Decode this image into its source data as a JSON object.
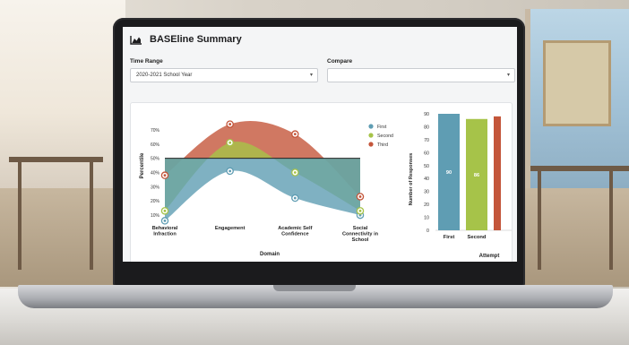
{
  "app": {
    "title": "BASEline Summary",
    "icon": "area-chart-icon"
  },
  "filters": {
    "time_range_label": "Time Range",
    "time_range_value": "2020-2021 School Year",
    "compare_label": "Compare",
    "compare_value": ""
  },
  "colors": {
    "first": "#5f9db3",
    "second": "#a6c349",
    "third": "#c4563b"
  },
  "chart_data": [
    {
      "type": "area",
      "xlabel": "Domain",
      "ylabel": "Percentile",
      "categories": [
        "Behavioral Infraction",
        "Engagement",
        "Academic Self Confidence",
        "Social Connectivity in School"
      ],
      "yticks": [
        "10%",
        "20%",
        "30%",
        "40%",
        "50%",
        "60%",
        "70%"
      ],
      "ylim": [
        5,
        75
      ],
      "reference_line": 50,
      "legend_position": "top-right",
      "series": [
        {
          "name": "First",
          "values": [
            6,
            41,
            22,
            10
          ]
        },
        {
          "name": "Second",
          "values": [
            13,
            61,
            40,
            13
          ]
        },
        {
          "name": "Third",
          "values": [
            38,
            74,
            67,
            23
          ]
        }
      ]
    },
    {
      "type": "bar",
      "xlabel": "Attempt",
      "ylabel": "Number of Responses",
      "categories": [
        "First",
        "Second"
      ],
      "values": [
        90,
        86
      ],
      "ylim": [
        0,
        90
      ],
      "yticks": [
        "0",
        "10",
        "20",
        "30",
        "40",
        "50",
        "60",
        "70",
        "80",
        "90"
      ]
    }
  ]
}
